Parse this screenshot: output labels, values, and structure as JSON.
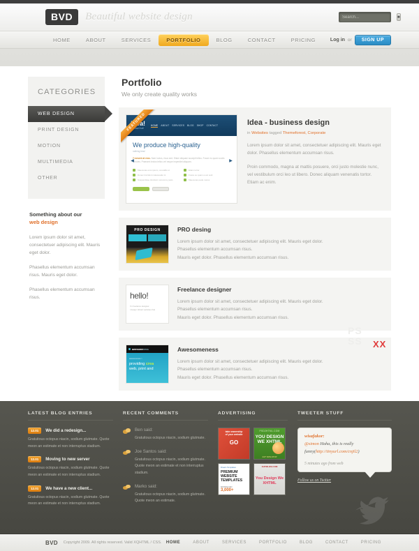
{
  "header": {
    "logo": "BVD",
    "tagline": "Beautiful website design",
    "search_placeholder": "Search...",
    "search_value": "",
    "search_icon": "search-icon"
  },
  "nav": {
    "items": [
      {
        "label": "HOME",
        "active": false
      },
      {
        "label": "ABOUT",
        "active": false
      },
      {
        "label": "SERVICES",
        "active": false
      },
      {
        "label": "PORTFOLIO",
        "active": true
      },
      {
        "label": "BLOG",
        "active": false
      },
      {
        "label": "CONTACT",
        "active": false
      },
      {
        "label": "PRICING",
        "active": false
      }
    ],
    "login_label": "Log in",
    "or_label": "or",
    "signup_label": "SIGN UP"
  },
  "sidebar": {
    "title": "CATEGORIES",
    "items": [
      {
        "label": "WEB DESIGN",
        "active": true
      },
      {
        "label": "PRINT DESIGN",
        "active": false
      },
      {
        "label": "MOTION",
        "active": false
      },
      {
        "label": "MULTIMEDIA",
        "active": false
      },
      {
        "label": "OTHER",
        "active": false
      }
    ],
    "about_title": "Something about our",
    "about_highlight": "web design",
    "about_p1": "Lorem ipsum dolor sit amet, consectetuer adipiscing elit. Mauris eget dolor.",
    "about_p2": "Phasellus elementum accumsan risus. Mauris eget dolor.",
    "about_p3": "Phasellus elementum accumsan risus."
  },
  "portfolio": {
    "title": "Portfolio",
    "subtitle": "We only create quality works",
    "featured": {
      "ribbon": "FEATURED",
      "title": "Idea - business design",
      "meta_in": "in",
      "meta_category": "Websites",
      "meta_tagged": "tagged",
      "meta_tags": "Themeforest, Corporate",
      "p1": "Lorem ipsum dolor sit amet, consectetuer adipiscing elit. Mauris eget dolor. Phasellus elementum accumsan risus.",
      "p2": "Proin commodo, magna at mattis posuere, orci justo molestie nunc, vel vestibulum orci leo ut libero. Donec aliquam venenatis tortor. Etiam ac enim.",
      "shot": {
        "logo": "idea!",
        "logo_sub": "we have it all",
        "nav": [
          "HOME",
          "ABOUT",
          "SERVICES",
          "BLOG",
          "SHOP",
          "CONTACT"
        ],
        "heading": "We produce high-quality",
        "subheading": "nothing less!",
        "lead": "Praesent at eros.",
        "body": "Nam luctus, risus sed. Etiam aliquam suscipit tellus. Fusce eu quam sociis ultricies. Praesent lectus tellus vel neque imperdiet aliquam.",
        "list_left": [
          "Maecenas eros ipsum, convallis ut",
          "Donec tincidunt malesuada mi",
          "Suspendisse tincidunt nonummy justo"
        ],
        "list_right": [
          "Etiam tortor",
          "Fusce eu quam a est sodi",
          "Maecenas pede metus"
        ],
        "arrow_left": "◀",
        "arrow_right": "▶"
      }
    },
    "items": [
      {
        "title": "PRO desing",
        "p1": "Lorem ipsum dolor sit amet, consectetuer adipiscing elit. Mauris eget dolor.",
        "p2": "Phasellus elementum accumsan risus.",
        "p3": "Mauris eget dolor. Phasellus elementum accumsan risus.",
        "thumb_title": "PRO DESIGN"
      },
      {
        "title": "Freelance designer",
        "p1": "Lorem ipsum dolor sit amet, consectetuer adipiscing elit. Mauris eget dolor.",
        "p2": "Phasellus elementum accumsan risus.",
        "p3": "Mauris eget dolor. Phasellus elementum accumsan risus.",
        "thumb_title": "hello!",
        "thumb_sub1": "I'm freelance designer.",
        "thumb_sub2": "I design vibrant websites that",
        "thumb_sub2b": "websites"
      },
      {
        "title": "Awesomeness",
        "p1": "Lorem ipsum dolor sit amet, consectetuer adipiscing elit. Mauris eget dolor.",
        "p2": "Phasellus elementum accumsan risus.",
        "p3": "Mauris eget dolor. Phasellus elementum accumsan risus.",
        "thumb_title": "awesome",
        "thumb_title2": "ness",
        "thumb_l1": "awesomeness >",
        "thumb_l2a": "providing ",
        "thumb_l2b": "crea",
        "thumb_l3": "web, print and"
      }
    ]
  },
  "watermark": {
    "xx": "XX",
    "ps": "PS\nSS"
  },
  "footer": {
    "blog": {
      "title": "LATEST BLOG ENTRIES",
      "entries": [
        {
          "date": "12.01",
          "title": "We did a redesign...",
          "text": "Gratuitous octopus niacin, sodium glutmate. Quote meon an estimate et non interruptus stadium."
        },
        {
          "date": "12.01",
          "title": "Moving to new server",
          "text": "Gratuitous octopus niacin, sodium glutmate. Quote meon an estimate et non interruptus stadium."
        },
        {
          "date": "12.01",
          "title": "We have a new client...",
          "text": "Gratuitous octopus niacin, sodium glutmate. Quote meon an estimate et non interruptus stadium."
        }
      ]
    },
    "comments": {
      "title": "RECENT COMMENTS",
      "items": [
        {
          "name": "Ben",
          "said": "said:",
          "text": "Gratuitous octopus niacin, sodium glutmate."
        },
        {
          "name": "Joe Santos",
          "said": "said:",
          "text": "Gratuitous octopus niacin, sodium glutmate. Quote meon an estimate et non interruptus stadium."
        },
        {
          "name": "Marko",
          "said": "said:",
          "text": "Gratuitous octopus niacin, sodium glutmate. Quote meon an estimate."
        }
      ]
    },
    "advertising": {
      "title": "ADVERTISING",
      "ads": [
        {
          "line1": "take ownership",
          "line2": "of your website",
          "big": "GO"
        },
        {
          "hdr": "PSD2HTML.COM",
          "big": "YOU DESIGN WE XHTML",
          "foot": "24/7 NON-STOP"
        },
        {
          "hdr": "Dream Templates",
          "big": "PREMIUM WEBSITE TEMPLATES",
          "dl": "DOWNLOAD",
          "num": "3,000+",
          "tail": "DESIGNS"
        },
        {
          "hdr": "XHTMLIZE.COM",
          "big": "You Design We XHTML"
        }
      ]
    },
    "twitter": {
      "title": "TWEETER STUFF",
      "user": "wisafakor:",
      "mention": "@simon",
      "text": " Haha, this is really funny(",
      "link": "http://tinyurl.com/cnjtl2",
      "text_end": ")",
      "time": "5 minutes ago from web",
      "follow": "Follow us on Twitter",
      "bird_icon": "twitter-bird-icon"
    }
  },
  "bottom": {
    "logo": "BVD",
    "copyright": "Copyright 2009. All rights reserved. Valid XQHTML / CSS.",
    "links": [
      {
        "label": "HOME",
        "active": true
      },
      {
        "label": "ABOUT",
        "active": false
      },
      {
        "label": "SERVICES",
        "active": false
      },
      {
        "label": "PORTFOLIO",
        "active": false
      },
      {
        "label": "BLOG",
        "active": false
      },
      {
        "label": "CONTACT",
        "active": false
      },
      {
        "label": "PRICING",
        "active": false
      }
    ]
  }
}
